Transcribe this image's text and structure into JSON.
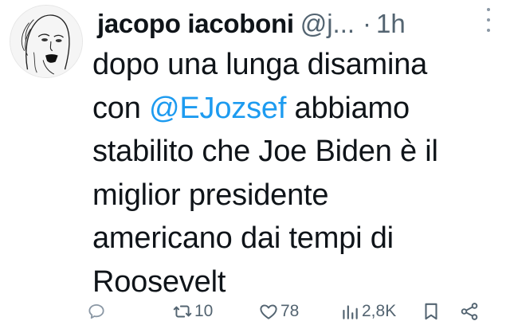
{
  "tweet": {
    "author_name": "jacopo iacoboni",
    "handle": "@j...",
    "separator": "·",
    "time": "1h",
    "text_lines": {
      "line1": "dopo una lunga disamina",
      "line2_prefix": "con ",
      "mention": "@EJozsef",
      "line2_suffix": " abbiamo",
      "line3": "stabilito che Joe Biden è il",
      "line4": "miglior presidente",
      "line5": "americano dai tempi di",
      "line6": "Roosevelt"
    },
    "accent_color": "#1d9bf0"
  },
  "actions": {
    "reply_icon": "reply-icon",
    "retweets": "10",
    "likes": "78",
    "views": "2,8K",
    "bookmark_icon": "bookmark-icon",
    "share_icon": "share-icon"
  }
}
